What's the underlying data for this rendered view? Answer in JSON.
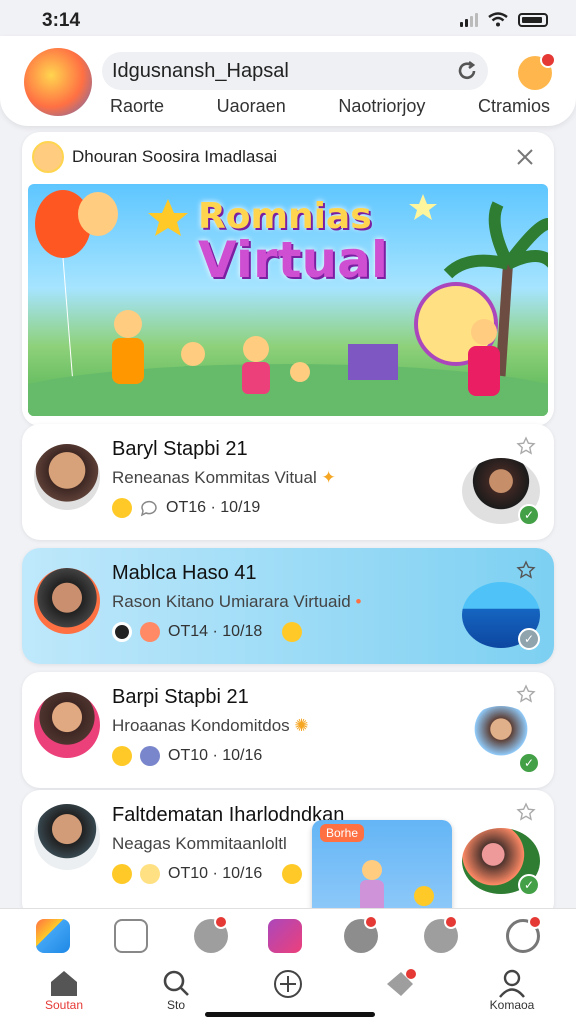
{
  "status_bar": {
    "time": "3:14"
  },
  "header": {
    "search_value": "Idgusnansh_Hapsal",
    "tabs": [
      "Raorte",
      "Uaoraen",
      "Naotriorjoy",
      "Ctramios"
    ]
  },
  "featured": {
    "title": "Dhouran Soosira Imadlasai",
    "banner_line1": "Romnias",
    "banner_line2": "Virtual"
  },
  "posts": [
    {
      "title": "Baryl Stapbi 21",
      "subtitle": "Reneanas Kommitas Vitual",
      "time": "OT16 · 10/19"
    },
    {
      "title": "Mablca Haso 41",
      "subtitle": "Rason Kitano Umiarara Virtuaid",
      "time": "OT14 · 10/18"
    },
    {
      "title": "Barpi Stapbi 21",
      "subtitle": "Hroaanas Kondomitdos",
      "time": "OT10 · 10/16"
    },
    {
      "title": "Faltdematan Iharlodndkan",
      "subtitle": "Neagas Kommitaanloltl",
      "time": "OT10 · 10/16"
    }
  ],
  "overlay_badge": "Borhe",
  "nav": [
    {
      "label": "Soutan"
    },
    {
      "label": "Sto"
    },
    {
      "label": ""
    },
    {
      "label": ""
    },
    {
      "label": "Komaoa"
    }
  ],
  "colors": {
    "accent": "#e53935",
    "highlight": "#7dd0f2",
    "success": "#43a047"
  }
}
